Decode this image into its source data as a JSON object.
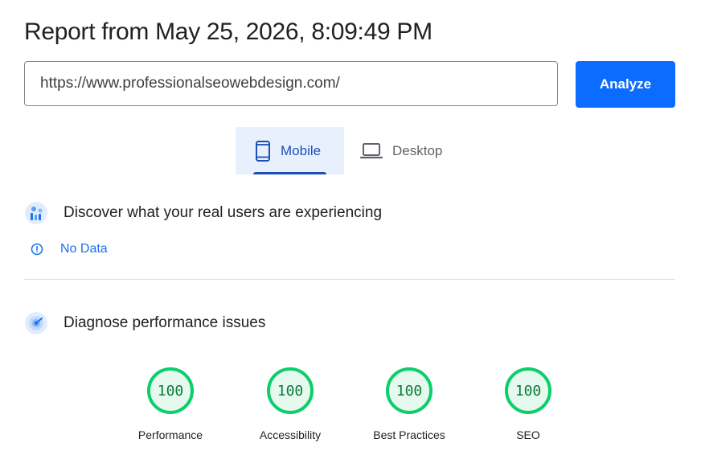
{
  "report": {
    "title": "Report from May 25, 2026, 8:09:49 PM"
  },
  "url_input": {
    "value": "https://www.professionalseowebdesign.com/"
  },
  "analyze_button": {
    "label": "Analyze",
    "color": "#0b6cff"
  },
  "device_tabs": [
    {
      "label": "Mobile",
      "icon": "smartphone-icon",
      "selected": true
    },
    {
      "label": "Desktop",
      "icon": "laptop-icon",
      "selected": false
    }
  ],
  "field_data": {
    "heading": "Discover what your real users are experiencing",
    "icon": "users-chart-icon",
    "status": "No Data",
    "status_icon": "info-icon"
  },
  "lab_data": {
    "heading": "Diagnose performance issues",
    "icon": "performance-icon",
    "scores": [
      {
        "label": "Performance",
        "value": "100",
        "score": 100
      },
      {
        "label": "Accessibility",
        "value": "100",
        "score": 100
      },
      {
        "label": "Best Practices",
        "value": "100",
        "score": 100
      },
      {
        "label": "SEO",
        "value": "100",
        "score": 100
      }
    ],
    "pass_color": "#0cce6b",
    "pass_text_color": "#0b7a3a"
  }
}
